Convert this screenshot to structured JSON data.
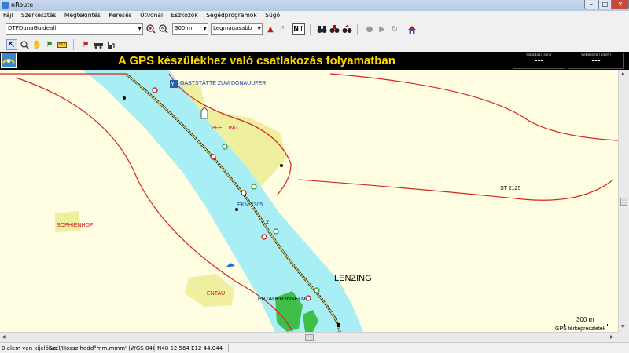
{
  "window": {
    "title": "nRoute",
    "min": "–",
    "max": "□",
    "close": "✕"
  },
  "menu": [
    "Fájl",
    "Szerkesztés",
    "Megtekintés",
    "Keresés",
    "Útvonal",
    "Eszközök",
    "Segédprogramok",
    "Súgó"
  ],
  "toolbar": {
    "map_select": "DTPDunaGuideall",
    "zoom_select": "300 m",
    "detail_select": "Legmagasabb",
    "north_label": "N↑"
  },
  "banner": {
    "message": "A GPS készülékhez való csatlakozás folyamatban",
    "heading_label": "Haladási irány",
    "heading_value": "---",
    "speed_label": "Sebesség (km/h)",
    "speed_value": "---"
  },
  "map": {
    "labels": {
      "gaststatte": "GASTSTÄTTE ZUM DONAUUFER",
      "pfelling": "PFELLING",
      "fkm": "FKM 2305",
      "buoy_num": "2",
      "sophienhof": "SOPHIENHOF",
      "st2125": "ST 2125",
      "lenzing": "LENZING",
      "entau": "ENTAU",
      "entauer_inseln": "ENTAUER INSELN"
    },
    "scale_value": "300 m",
    "scale_title": "GPS térképrészletek"
  },
  "status": {
    "selection": "0 elem van kijelölve",
    "format": "Szél/Hossz hddd°mm.mmm' (WGS 84)",
    "coords": "N48 52.564 E12 44.044"
  },
  "colors": {
    "river": "#a8eef5",
    "land": "#fffde2",
    "settlement": "#eef0a0",
    "road": "#d9231f",
    "forest": "#3dbf4a",
    "banner_text": "#ffd800"
  }
}
